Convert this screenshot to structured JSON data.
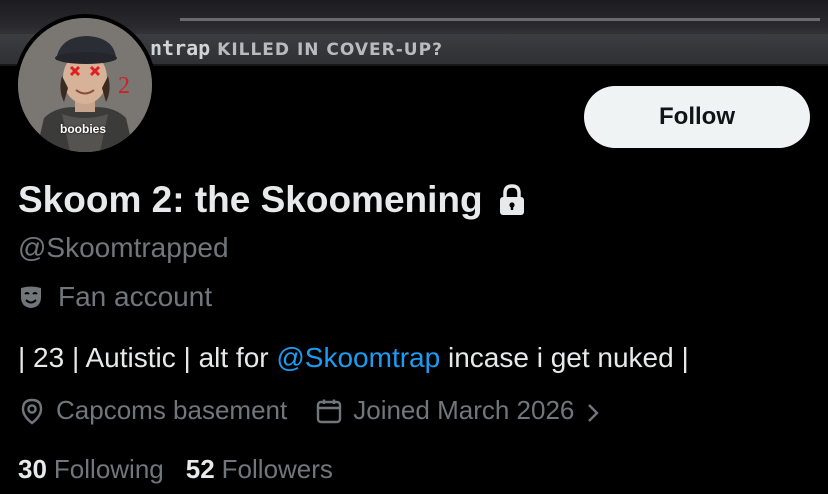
{
  "banner": {
    "headline_stylized": "ntrap",
    "headline_rest": "KILLED IN COVER-UP?"
  },
  "avatar": {
    "caption": "boobies",
    "badge": "2"
  },
  "follow_button": {
    "label": "Follow"
  },
  "profile": {
    "display_name": "Skoom 2: the Skoomening",
    "handle": "@Skoomtrapped",
    "category": "Fan account",
    "bio_prefix": "| 23 | Autistic | alt for ",
    "bio_mention": "@Skoomtrap",
    "bio_suffix": " incase i get nuked |",
    "location": "Capcoms basement",
    "joined": "Joined March 2026"
  },
  "stats": {
    "following_count": "30",
    "following_label": "Following",
    "followers_count": "52",
    "followers_label": "Followers"
  },
  "colors": {
    "background": "#000000",
    "primary_text": "#e7e9ea",
    "secondary_text": "#71767b",
    "link": "#1d9bf0",
    "follow_bg": "#eff3f4"
  }
}
